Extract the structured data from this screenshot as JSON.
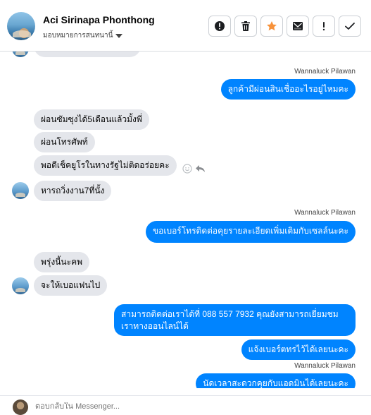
{
  "header": {
    "contact_name": "Aci Sirinapa Phonthong",
    "assign_label": "มอบหมายการสนทนานี้",
    "toolbar": [
      {
        "name": "mark-spam-button",
        "icon": "exclamation-circle-icon"
      },
      {
        "name": "delete-button",
        "icon": "trash-icon"
      },
      {
        "name": "star-button",
        "icon": "star-icon",
        "color": "#f7923a"
      },
      {
        "name": "mark-unread-button",
        "icon": "envelope-icon"
      },
      {
        "name": "follow-up-button",
        "icon": "exclamation-icon"
      },
      {
        "name": "mark-done-button",
        "icon": "check-icon"
      }
    ]
  },
  "messages": [
    {
      "id": "m1",
      "side": "out",
      "sender": "Wannaluck Pilawan",
      "text": "ลูกค้ามีผ่อนสินเชื่ออะไรอยู่ไหมคะ"
    },
    {
      "id": "m2",
      "side": "in",
      "text": "ผ่อนซัมซุงได้5เดือนแล้วมั้งพี่"
    },
    {
      "id": "m3",
      "side": "in",
      "text": "ผ่อนโทรศัพท์"
    },
    {
      "id": "m4",
      "side": "in",
      "text": "พอดีเช็คยูโรในทางรัฐไม่ติดอร่อยคะ"
    },
    {
      "id": "m5",
      "side": "in",
      "text": "หารถวิ่งงาน7ที่นั้ง"
    },
    {
      "id": "m6",
      "side": "out",
      "sender": "Wannaluck Pilawan",
      "text": "ขอเบอร์โทรติดต่อคุยรายละเอียดเพิ่มเติมกับเซลล์นะคะ"
    },
    {
      "id": "m7",
      "side": "in",
      "text": "พรุ่งนี้นะคพ"
    },
    {
      "id": "m8",
      "side": "in",
      "text": "จะให้เบอแฟนไป"
    },
    {
      "id": "m9",
      "side": "out",
      "text_line1": "สามารถติดต่อเราได้ที่ 088 557 7932 คุณยังสามารถเยี่ยมชม",
      "text_line2": "เราทางออนไลน์ได้"
    },
    {
      "id": "m10",
      "side": "out",
      "text": "แจ้งเบอร์ตทรไว้ได้เลยนะคะ"
    },
    {
      "id": "m11",
      "side": "out",
      "sender": "Wannaluck Pilawan",
      "text": "นัดเวลาสะดวกคุยกับแอดมินได้เลยนะคะ"
    }
  ],
  "composer": {
    "placeholder": "ตอบกลับใน Messenger..."
  },
  "colors": {
    "outgoing_bubble": "#0084ff",
    "incoming_bubble": "#e4e6eb",
    "star": "#f7923a"
  }
}
